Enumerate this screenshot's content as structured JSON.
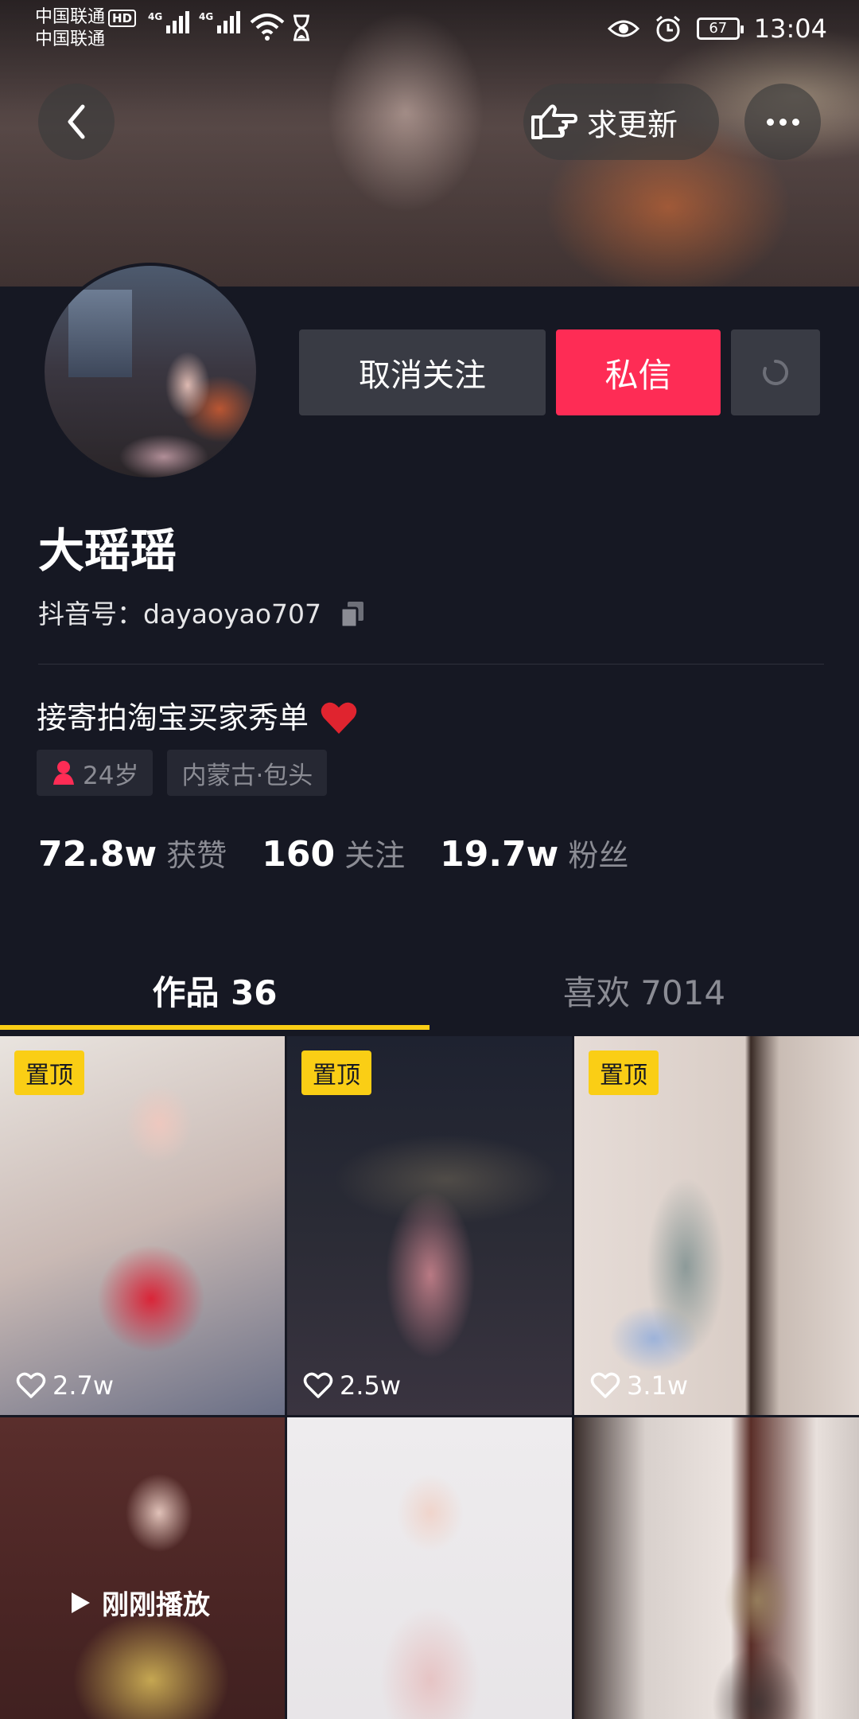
{
  "status_bar": {
    "carrier1": "中国联通",
    "carrier2": "中国联通",
    "hd_badge": "HD",
    "network1": "4G",
    "network2": "4G",
    "battery": "67",
    "time": "13:04",
    "icons": [
      "wifi-icon",
      "hourglass-icon",
      "eye-icon",
      "alarm-icon"
    ]
  },
  "header": {
    "urge_update_label": "求更新"
  },
  "actions": {
    "unfollow_label": "取消关注",
    "message_label": "私信"
  },
  "profile": {
    "name": "大瑶瑶",
    "douyin_id_label": "抖音号：",
    "douyin_id": "dayaoyao707",
    "bio": "接寄拍淘宝买家秀单",
    "tags": {
      "age": "24岁",
      "location": "内蒙古·包头"
    }
  },
  "stats": {
    "likes_value": "72.8w",
    "likes_label": "获赞",
    "following_value": "160",
    "following_label": "关注",
    "fans_value": "19.7w",
    "fans_label": "粉丝"
  },
  "tabs": {
    "works": "作品 36",
    "liked": "喜欢 7014"
  },
  "videos": [
    {
      "pinned_label": "置顶",
      "likes": "2.7w"
    },
    {
      "pinned_label": "置顶",
      "likes": "2.5w"
    },
    {
      "pinned_label": "置顶",
      "likes": "3.1w"
    },
    {
      "just_played": "刚刚播放"
    },
    {},
    {}
  ],
  "colors": {
    "background": "#161823",
    "accent_red": "#fe2c55",
    "accent_yellow": "#face15",
    "secondary_text": "#8b8c94"
  }
}
